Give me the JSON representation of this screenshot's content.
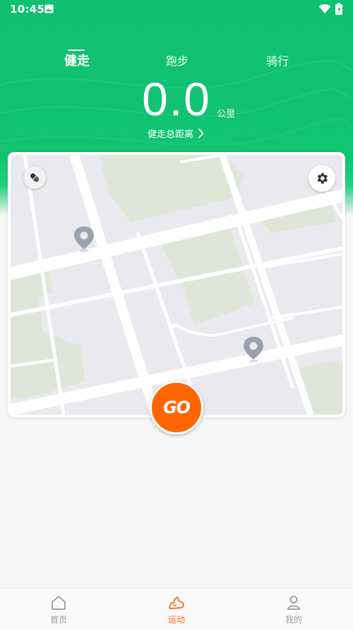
{
  "status_bar": {
    "time": "10:45"
  },
  "tabs": [
    {
      "label": "健走",
      "active": true
    },
    {
      "label": "跑步",
      "active": false
    },
    {
      "label": "骑行",
      "active": false
    }
  ],
  "distance": {
    "value": "0.0",
    "unit": "公里",
    "label": "健走总距离"
  },
  "map": {
    "top_left_icon": "pill-icon",
    "top_right_icon": "gear-icon",
    "markers": [
      "location-pin-icon",
      "location-pin-icon"
    ]
  },
  "go_button": {
    "label": "GO"
  },
  "bottom_nav": [
    {
      "label": "首页",
      "icon": "home-icon",
      "active": false
    },
    {
      "label": "运动",
      "icon": "sneaker-icon",
      "active": true
    },
    {
      "label": "我的",
      "icon": "person-icon",
      "active": false
    }
  ],
  "colors": {
    "brand_green": "#10c472",
    "accent_orange": "#ff6600",
    "nav_active": "#f26a1b",
    "nav_inactive": "#9a9a9a"
  }
}
